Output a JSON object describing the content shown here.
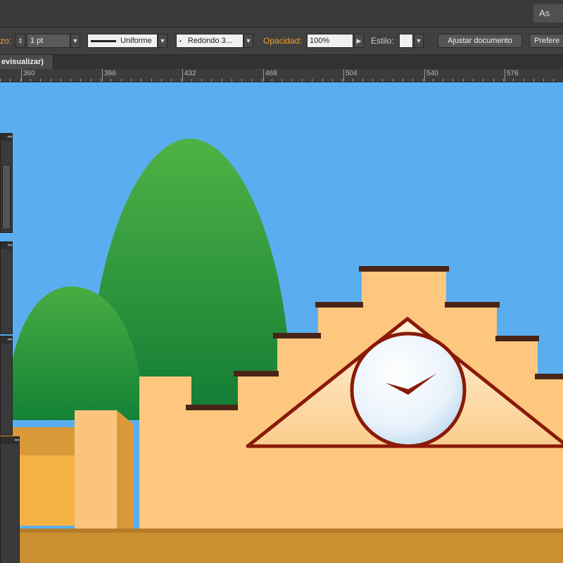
{
  "app": {
    "workspace_label": "As"
  },
  "control_bar": {
    "stroke_label": "zo:",
    "stroke_weight": "1 pt",
    "stroke_style": "Uniforme",
    "brush": "Redondo 3...",
    "opacity_label": "Opacidad:",
    "opacity_value": "100%",
    "style_label": "Estilo:",
    "adjust_document": "Ajustar documento",
    "preferences": "Prefere"
  },
  "document_tab": {
    "label": "evisualizar)"
  },
  "ruler": {
    "labels": [
      "360",
      "396",
      "432",
      "468",
      "504",
      "540",
      "576"
    ]
  },
  "artwork": {
    "sky_color": "#5aaef0",
    "hill_color": "#2f9a3f",
    "building_color": "#fdc77f",
    "roof_trim_color": "#4a2416",
    "clock_frame_color": "#8a1a08",
    "ground_color": "#c98f30"
  },
  "icons": {
    "stepper": "stepper-icon",
    "dropdown": "chevron-down-icon",
    "play": "play-icon"
  }
}
